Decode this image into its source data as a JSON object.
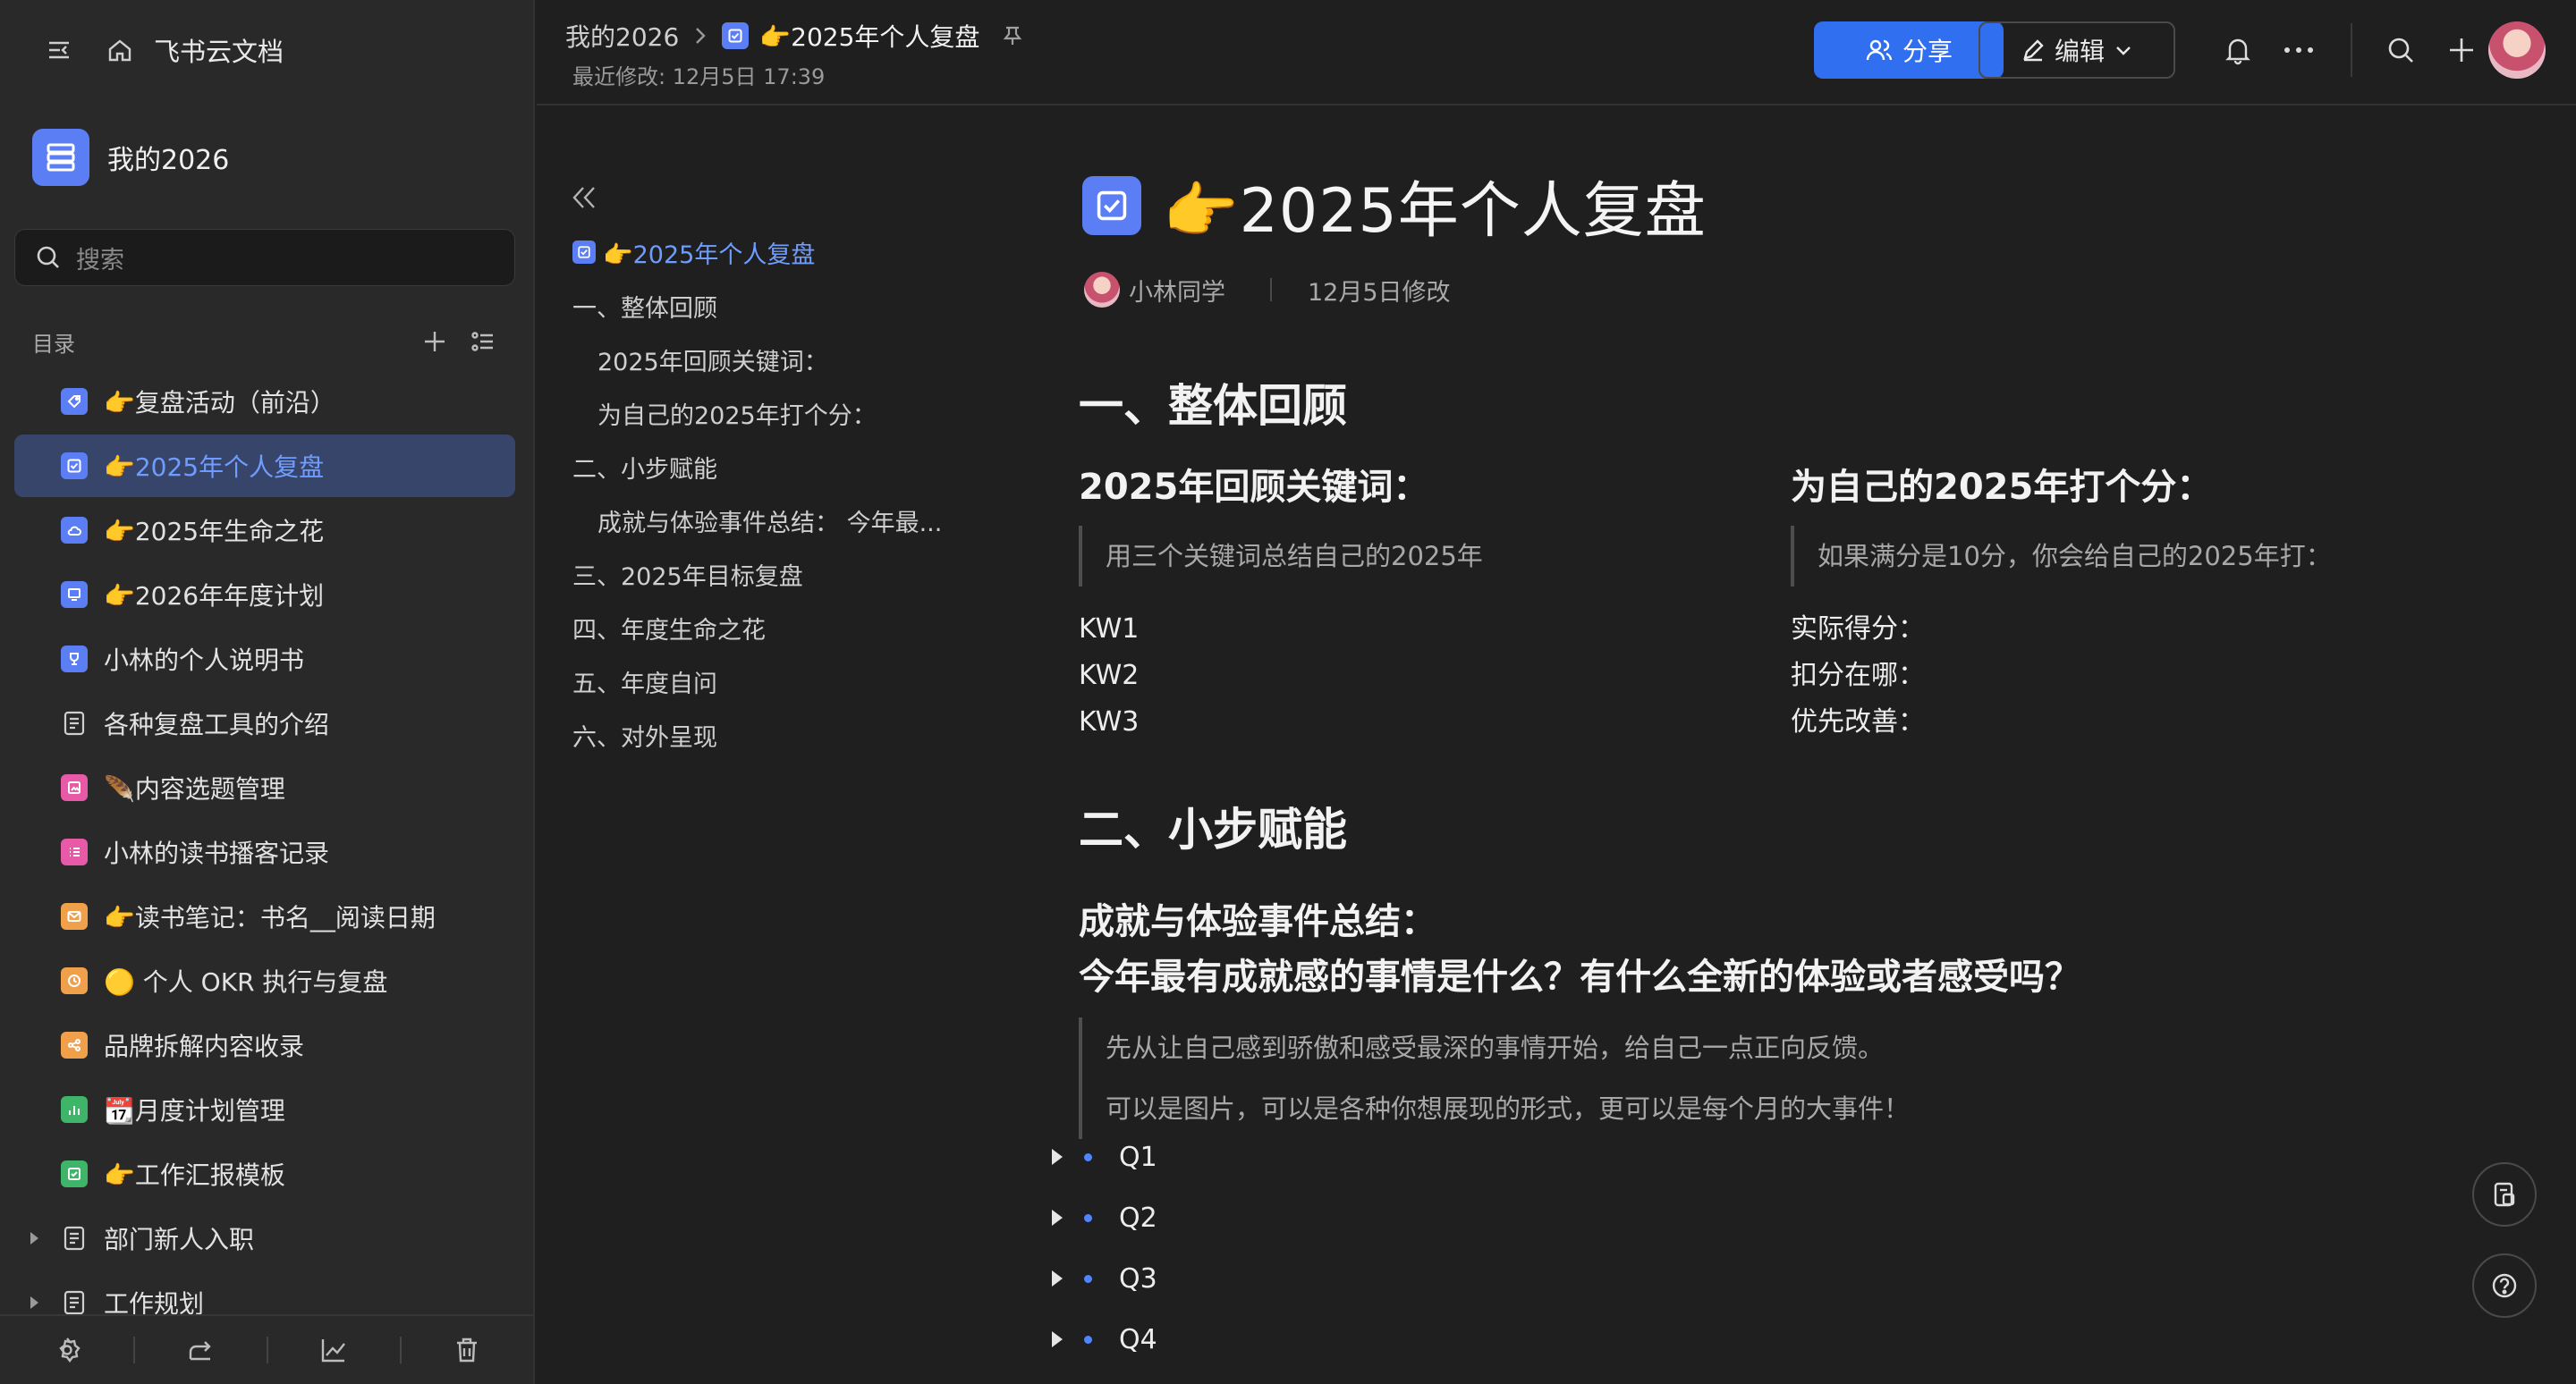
{
  "sidebar": {
    "app_name": "飞书云文档",
    "space_name": "我的2026",
    "search_placeholder": "搜索",
    "toc_label": "目录",
    "items": [
      {
        "label": "👉复盘活动（前沿）",
        "icon_color": "#5b7ef4"
      },
      {
        "label": "👉2025年个人复盘",
        "icon_color": "#5b7ef4"
      },
      {
        "label": "👉2025年生命之花",
        "icon_color": "#5b7ef4"
      },
      {
        "label": "👉2026年年度计划",
        "icon_color": "#5b7ef4"
      },
      {
        "label": "小林的个人说明书",
        "icon_color": "#5b7ef4"
      },
      {
        "label": "各种复盘工具的介绍",
        "icon_color": "none"
      },
      {
        "label": "🪶内容选题管理",
        "icon_color": "#e85aa8"
      },
      {
        "label": "小林的读书播客记录",
        "icon_color": "#e85aa8"
      },
      {
        "label": "👉读书笔记：书名__阅读日期",
        "icon_color": "#f0a04b"
      },
      {
        "label": "🟡 个人 OKR 执行与复盘",
        "icon_color": "#f0a04b"
      },
      {
        "label": "品牌拆解内容收录",
        "icon_color": "#f0a04b"
      },
      {
        "label": "📆月度计划管理",
        "icon_color": "#3fb56a"
      },
      {
        "label": "👉工作汇报模板",
        "icon_color": "#3fb56a"
      },
      {
        "label": "部门新人入职",
        "icon_color": "none"
      },
      {
        "label": "工作规划",
        "icon_color": "none"
      }
    ]
  },
  "topbar": {
    "breadcrumb_root": "我的2026",
    "breadcrumb_current": "👉2025年个人复盘",
    "last_modified": "最近修改: 12月5日 17:39",
    "share_label": "分享",
    "edit_label": "编辑",
    "accent": "#2f6ff0"
  },
  "outline": [
    {
      "label": "👉2025年个人复盘",
      "level": 1,
      "active": true
    },
    {
      "label": "一、整体回顾",
      "level": 1
    },
    {
      "label": "2025年回顾关键词：",
      "level": 2
    },
    {
      "label": "为自己的2025年打个分：",
      "level": 2
    },
    {
      "label": "二、小步赋能",
      "level": 1
    },
    {
      "label": "成就与体验事件总结： 今年最...",
      "level": 2
    },
    {
      "label": "三、2025年目标复盘",
      "level": 1
    },
    {
      "label": "四、年度生命之花",
      "level": 1
    },
    {
      "label": "五、年度自问",
      "level": 1
    },
    {
      "label": "六、对外呈现",
      "level": 1
    }
  ],
  "doc": {
    "title": "👉2025年个人复盘",
    "author": "小林同学",
    "modified": "12月5日修改",
    "section1_title": "一、整体回顾",
    "keywords_title": "2025年回顾关键词：",
    "keywords_hint": "用三个关键词总结自己的2025年",
    "keywords": [
      "KW1",
      "KW2",
      "KW3"
    ],
    "score_title": "为自己的2025年打个分：",
    "score_hint": "如果满分是10分，你会给自己的2025年打：",
    "score_lines": [
      "实际得分：",
      "扣分在哪：",
      "优先改善："
    ],
    "section2_title": "二、小步赋能",
    "achievement_title_1": "成就与体验事件总结：",
    "achievement_title_2": "今年最有成就感的事情是什么？有什么全新的体验或者感受吗？",
    "achievement_hint_1": "先从让自己感到骄傲和感受最深的事情开始，给自己一点正向反馈。",
    "achievement_hint_2": "可以是图片，可以是各种你想展现的形式，更可以是每个月的大事件！",
    "quarters": [
      "Q1",
      "Q2",
      "Q3",
      "Q4"
    ]
  }
}
